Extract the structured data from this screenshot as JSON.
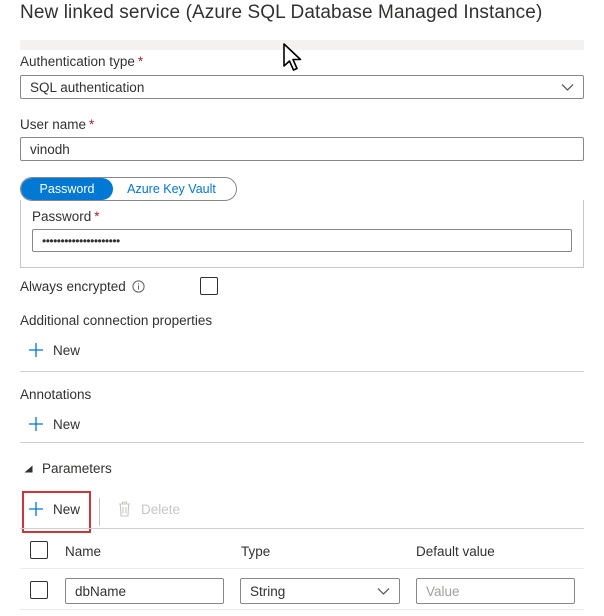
{
  "dialog": {
    "title": "New linked service (Azure SQL Database Managed Instance)"
  },
  "auth": {
    "label": "Authentication type",
    "required_mark": "*",
    "value": "SQL authentication"
  },
  "username": {
    "label": "User name",
    "required_mark": "*",
    "value": "vinodh"
  },
  "credential_toggle": {
    "options": [
      "Password",
      "Azure Key Vault"
    ],
    "selected": "Password"
  },
  "password": {
    "label": "Password",
    "required_mark": "*",
    "value": "•••••••••••••••••••••"
  },
  "always_encrypted": {
    "label": "Always encrypted",
    "checked": false
  },
  "connection_props": {
    "label": "Additional connection properties",
    "new_label": "New"
  },
  "annotations": {
    "label": "Annotations",
    "new_label": "New"
  },
  "parameters": {
    "label": "Parameters",
    "new_label": "New",
    "delete_label": "Delete",
    "columns": [
      "Name",
      "Type",
      "Default value"
    ],
    "rows": [
      {
        "name": "dbName",
        "type": "String",
        "default_placeholder": "Value"
      }
    ]
  },
  "colors": {
    "accent": "#0078d4",
    "highlight": "#d13438",
    "required": "#a4262c"
  }
}
